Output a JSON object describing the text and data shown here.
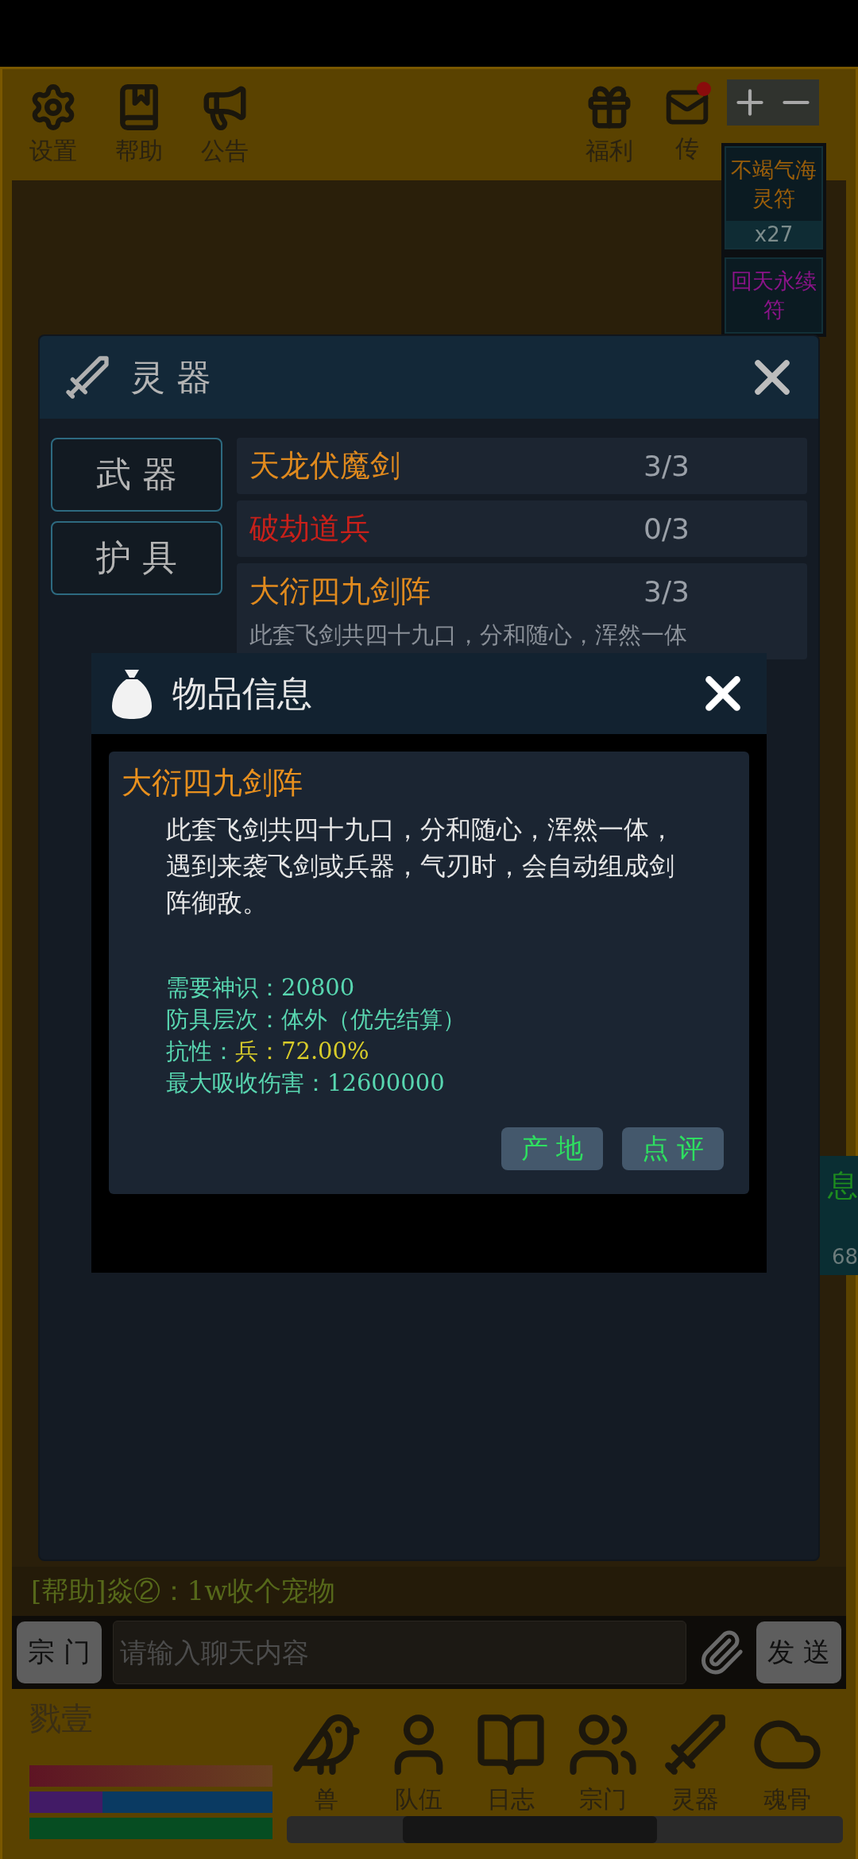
{
  "toolbar": {
    "left": [
      {
        "label": "设置"
      },
      {
        "label": "帮助"
      },
      {
        "label": "公告"
      }
    ],
    "right": [
      {
        "label": "福利",
        "badge": false
      },
      {
        "label": "传",
        "badge": true
      }
    ]
  },
  "buffs": [
    {
      "name": "不竭气海灵符",
      "count": "x27",
      "color": "#9a5e0a"
    },
    {
      "name": "回天永续符",
      "color": "#8a1488"
    }
  ],
  "side_badge": {
    "label": "息",
    "count": "68"
  },
  "equipment_panel": {
    "title": "灵 器",
    "tabs": [
      "武 器",
      "护 具"
    ],
    "items": [
      {
        "name": "天龙伏魔剑",
        "count": "3/3",
        "color": "#e08a1e"
      },
      {
        "name": "破劫道兵",
        "count": "0/3",
        "color": "#c8201a"
      },
      {
        "name": "大衍四九剑阵",
        "count": "3/3",
        "color": "#e08a1e",
        "description": "此套飞剑共四十九口，分和随心，浑然一体"
      }
    ]
  },
  "item_dialog": {
    "title": "物品信息",
    "name": "大衍四九剑阵",
    "description": "此套飞剑共四十九口，分和随心，浑然一体，遇到来袭飞剑或兵器，气刃时，会自动组成剑阵御敌。",
    "stats": [
      {
        "label": "需要神识：",
        "value": "20800",
        "highlight": false
      },
      {
        "label": "防具层次：",
        "value": "体外（优先结算）",
        "highlight": false
      },
      {
        "label": "抗性：",
        "value": "兵：72.00%",
        "highlight": true
      },
      {
        "label": "最大吸收伤害：",
        "value": "12600000",
        "highlight": false
      }
    ],
    "buttons": [
      "产 地",
      "点 评"
    ]
  },
  "chat": {
    "last_message": "[帮助]焱②：1w收个宠物",
    "channel_button": "宗 门",
    "input_placeholder": "请输入聊天内容",
    "send_button": "发 送"
  },
  "player": {
    "name": "戮壹",
    "bars": [
      {
        "kind": "health",
        "level": 1
      },
      {
        "kind": "mana",
        "level": 0.3
      },
      {
        "kind": "stamina",
        "level": 1
      }
    ]
  },
  "nav": [
    {
      "label": "兽"
    },
    {
      "label": "队伍"
    },
    {
      "label": "日志"
    },
    {
      "label": "宗门"
    },
    {
      "label": "灵器"
    },
    {
      "label": "魂骨"
    }
  ]
}
